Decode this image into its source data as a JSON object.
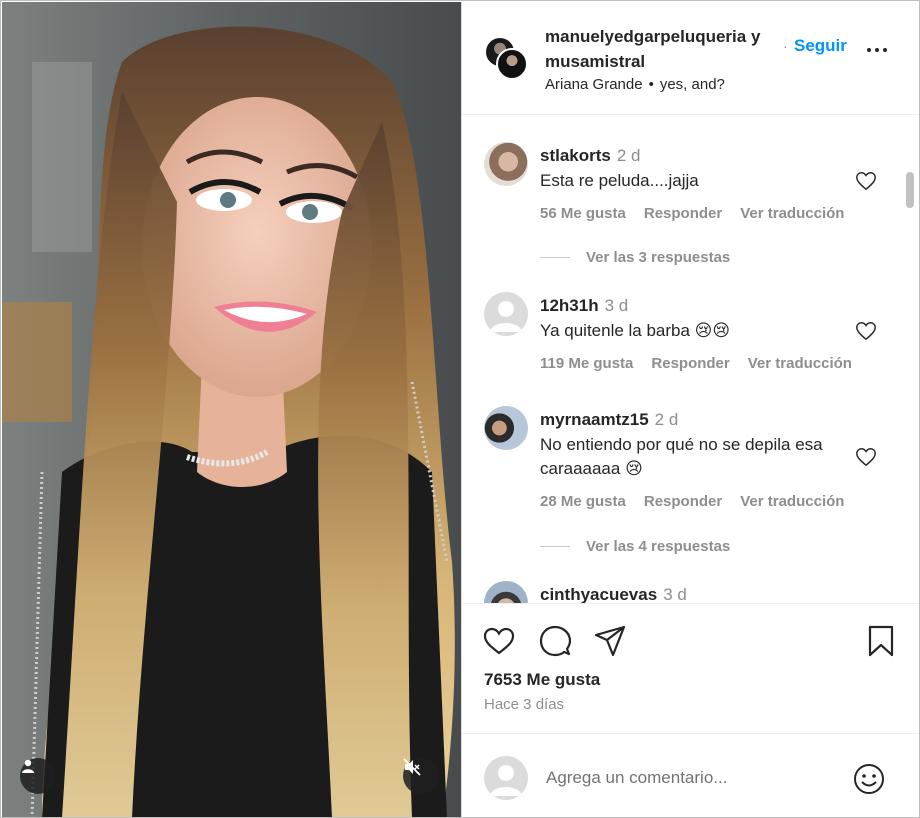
{
  "post": {
    "authors": "manuelyedgarpeluqueria y musamistral",
    "dot": "·",
    "follow_label": "Seguir",
    "audio_artist": "Ariana Grande",
    "audio_sep": "•",
    "audio_title": "yes, and?"
  },
  "comments": [
    {
      "user": "stlakorts",
      "time": "2 d",
      "text": "Esta re peluda....jajja",
      "likes": "56 Me gusta",
      "reply": "Responder",
      "translate": "Ver traducción",
      "replies": "Ver las 3 respuestas"
    },
    {
      "user": "12h31h",
      "time": "3 d",
      "text": "Ya quitenle la barba 😢😢",
      "likes": "119 Me gusta",
      "reply": "Responder",
      "translate": "Ver traducción"
    },
    {
      "user": "myrnaamtz15",
      "time": "2 d",
      "text": "No entiendo por qué no se depila esa caraaaaaa 😢",
      "likes": "28 Me gusta",
      "reply": "Responder",
      "translate": "Ver traducción",
      "replies": "Ver las 4 respuestas"
    },
    {
      "user": "cinthyacuevas",
      "time": "3 d"
    }
  ],
  "footer": {
    "likes": "7653 Me gusta",
    "ago": "Hace 3 días"
  },
  "composer": {
    "placeholder": "Agrega un comentario..."
  },
  "icons": {
    "like": "heart-icon",
    "comment": "comment-icon",
    "share": "send-icon",
    "save": "bookmark-icon",
    "emoji": "emoji-icon",
    "mute": "muted-speaker-icon",
    "tagged": "user-icon",
    "more": "more-icon"
  },
  "colors": {
    "accent": "#0095f6",
    "text": "#262626",
    "muted": "#8e8e8e"
  }
}
